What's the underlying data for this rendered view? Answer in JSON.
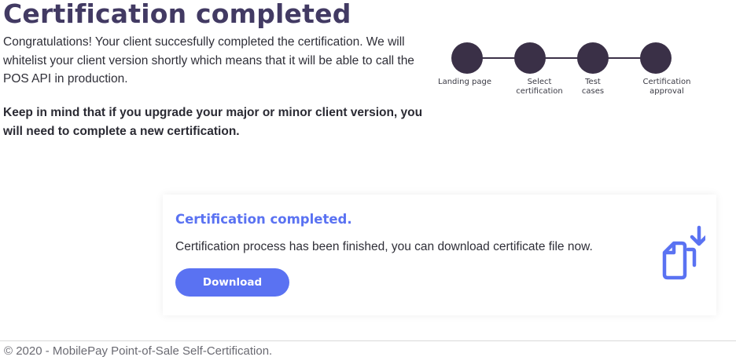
{
  "header": {
    "title": "Certification completed",
    "intro": "Congratulations! Your client succesfully completed the certification. We will whitelist your client version shortly which means that it will be able to call the POS API in production.",
    "note": "Keep in mind that if you upgrade your major or minor client version, you will need to complete a new certification."
  },
  "stepper": {
    "steps": [
      {
        "label": "Landing page"
      },
      {
        "label": "Select certification"
      },
      {
        "label": "Test cases"
      },
      {
        "label": "Certification approval"
      }
    ],
    "dot_color": "#3a3047"
  },
  "card": {
    "title": "Certification completed.",
    "text": "Certification process has been finished, you can download certificate file now.",
    "button_label": "Download",
    "icon": "download-file-icon",
    "accent_color": "#5a72f2"
  },
  "footer": {
    "text": "© 2020 - MobilePay Point-of-Sale Self-Certification."
  }
}
